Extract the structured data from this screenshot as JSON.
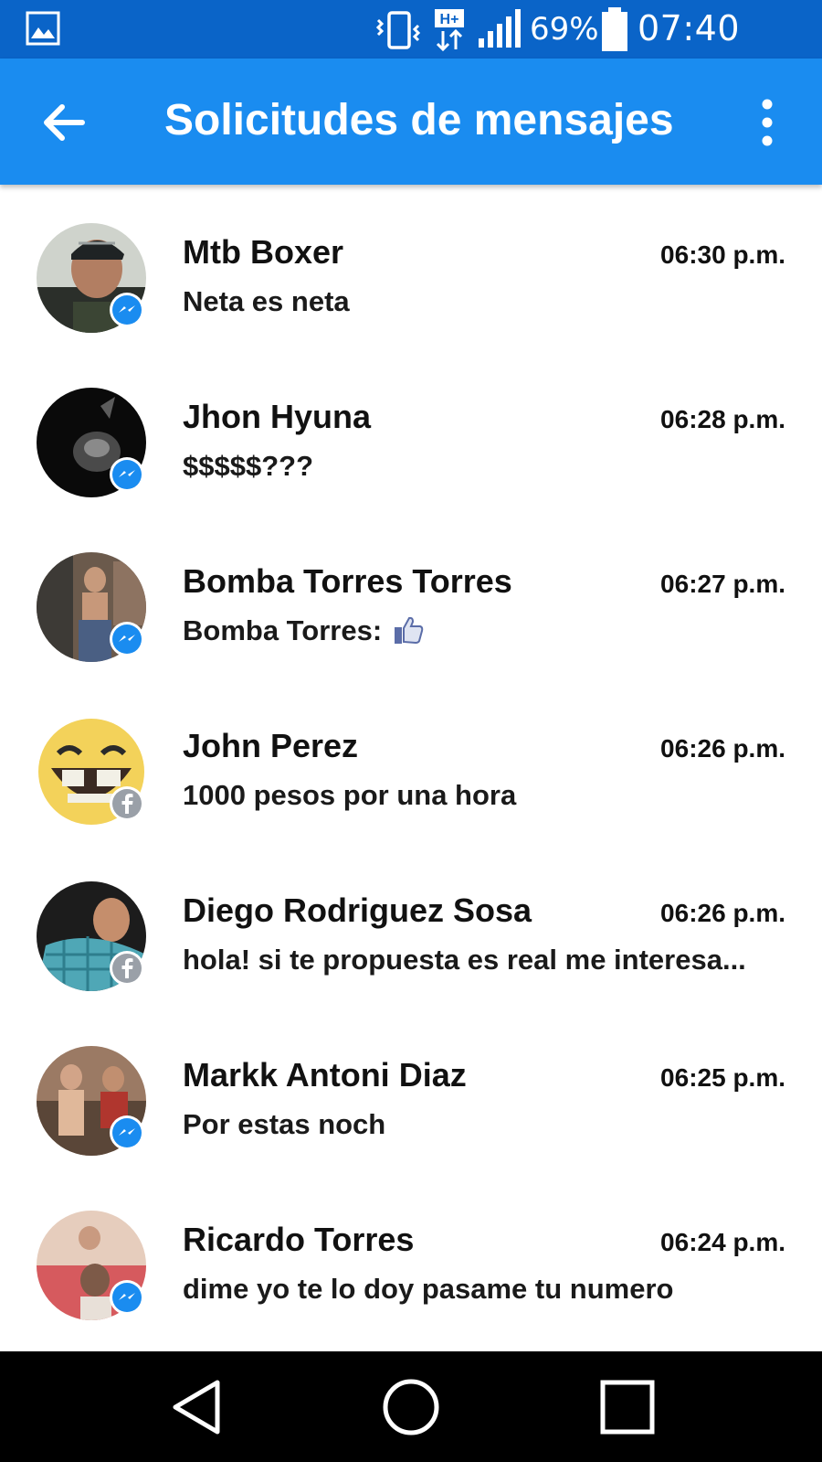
{
  "status_bar": {
    "battery_percent": "69%",
    "time": "07:40 p.m.",
    "network_type": "H+",
    "colors": {
      "background": "#0a64c8"
    }
  },
  "app_bar": {
    "title": "Solicitudes de mensajes",
    "back_icon": "arrow-left-icon",
    "menu_icon": "more-vert-icon",
    "colors": {
      "background": "#1a8cf0"
    }
  },
  "messages": [
    {
      "name": "Mtb Boxer",
      "time": "06:30 p.m.",
      "preview": "Neta es neta",
      "source": "messenger"
    },
    {
      "name": "Jhon Hyuna",
      "time": "06:28 p.m.",
      "preview": "$$$$$???",
      "source": "messenger"
    },
    {
      "name": "Bomba Torres Torres",
      "time": "06:27 p.m.",
      "preview": "Bomba Torres:",
      "source": "messenger",
      "preview_icon": "thumbs-up-icon"
    },
    {
      "name": "John Perez",
      "time": "06:26 p.m.",
      "preview": "1000 pesos por una hora",
      "source": "facebook"
    },
    {
      "name": "Diego Rodriguez Sosa",
      "time": "06:26 p.m.",
      "preview": "hola! si te propuesta es real me interesa...",
      "source": "facebook"
    },
    {
      "name": "Markk Antoni Diaz",
      "time": "06:25 p.m.",
      "preview": "Por estas  noch",
      "source": "messenger"
    },
    {
      "name": "Ricardo Torres",
      "time": "06:24 p.m.",
      "preview": "dime yo te lo doy pasame tu numero",
      "source": "messenger"
    }
  ],
  "nav_bar": {
    "back_icon": "triangle-back-icon",
    "home_icon": "circle-home-icon",
    "recent_icon": "square-recents-icon"
  }
}
